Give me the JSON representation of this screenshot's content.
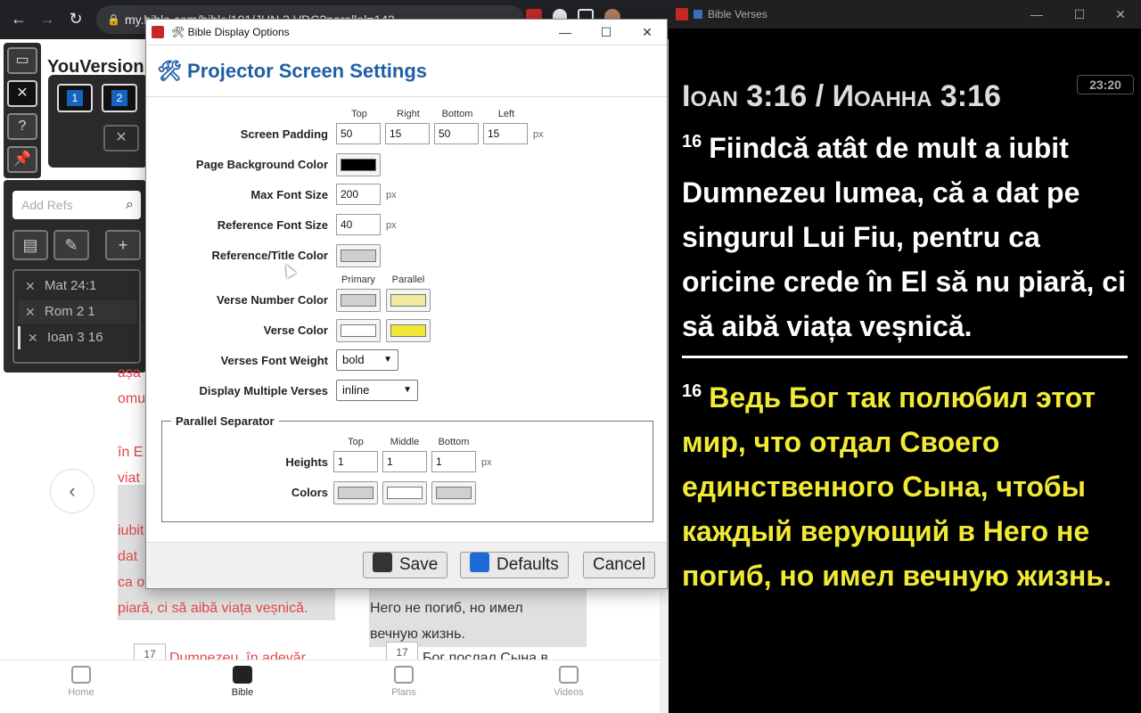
{
  "browser": {
    "url": "my.bible.com/bible/191/JHN.3.VDC?parallel=143",
    "colors": {
      "chrome": "#202124"
    }
  },
  "page": {
    "logo": "YouVersion",
    "screens": [
      "1",
      "2"
    ],
    "refs_placeholder": "Add Refs",
    "refs": [
      "Mat 24:1",
      "Rom 2 1",
      "Ioan 3 16"
    ],
    "left_text": [
      "aṣa",
      "omu",
      "în E",
      "viat",
      "iubit",
      "dat",
      "ca o",
      "piară, ci să aibă viața veșnică."
    ],
    "right_text": [
      "Него не погиб, но имел",
      "вечную жизнь."
    ],
    "verse17_num": "17",
    "verse17_left": "Dumnezeu, în adevăr,",
    "verse17_right": "Бог послал Сына в",
    "nav": [
      {
        "label": "Home",
        "icon": "home-icon"
      },
      {
        "label": "Bible",
        "icon": "bible-icon"
      },
      {
        "label": "Plans",
        "icon": "plans-icon"
      },
      {
        "label": "Videos",
        "icon": "videos-icon"
      }
    ]
  },
  "dialog": {
    "window_title": "🛠 Bible Display Options",
    "heading": "🛠 Projector Screen Settings",
    "labels": {
      "screen_padding": "Screen Padding",
      "page_bg": "Page Background Color",
      "max_font": "Max Font Size",
      "ref_font": "Reference Font Size",
      "ref_title_color": "Reference/Title Color",
      "verse_num_color": "Verse Number Color",
      "verse_color": "Verse Color",
      "font_weight": "Verses Font Weight",
      "multiple_verses": "Display Multiple Verses",
      "parallel_sep": "Parallel Separator",
      "heights": "Heights",
      "colors": "Colors"
    },
    "padding_heads": [
      "Top",
      "Right",
      "Bottom",
      "Left"
    ],
    "padding_values": [
      "50",
      "15",
      "50",
      "15"
    ],
    "unit": "px",
    "max_font_value": "200",
    "ref_font_value": "40",
    "color_heads": [
      "Primary",
      "Parallel"
    ],
    "sep_heads": [
      "Top",
      "Middle",
      "Bottom"
    ],
    "sep_heights": [
      "1",
      "1",
      "1"
    ],
    "font_weight_value": "bold",
    "multiple_value": "inline",
    "swatches": {
      "page_bg": "#000000",
      "ref_title": "#d0d0d0",
      "verse_num_primary": "#d0d0d0",
      "verse_num_parallel": "#f0eba0",
      "verse_primary": "#ffffff",
      "verse_parallel": "#f0e935",
      "sep_top": "#d0d0d0",
      "sep_middle": "#ffffff",
      "sep_bottom": "#d0d0d0"
    },
    "buttons": {
      "save": "Save",
      "defaults": "Defaults",
      "cancel": "Cancel"
    }
  },
  "projector": {
    "window_title": "Bible Verses",
    "reference": "Ioan 3:16 / Иоанна 3:16",
    "clock": "23:20",
    "primary_num": "16",
    "primary_text": "Fiindcă atât de mult a iubit Dumnezeu lumea, că a dat pe singurul Lui Fiu, pentru ca oricine crede în El să nu piară, ci să aibă viața veșnică.",
    "secondary_num": "16",
    "secondary_text": "Ведь Бог так полюбил этот мир, что отдал Своего единственного Сына, чтобы каждый верующий в Него не погиб, но имел вечную жизнь.",
    "colors": {
      "background": "#000000",
      "primary": "#ffffff",
      "secondary": "#f0e935"
    }
  }
}
